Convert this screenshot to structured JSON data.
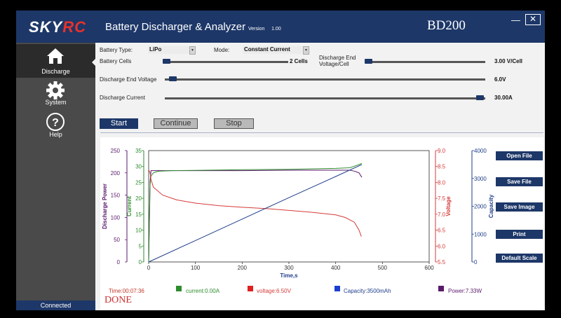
{
  "header": {
    "logo_sky": "SKY",
    "logo_rc": "RC",
    "title": "Battery Discharger & Analyzer",
    "version_label": "Version",
    "version_number": "1.00",
    "model": "BD200",
    "close_glyph": "✕",
    "minimize_glyph": "—"
  },
  "sidebar": {
    "items": [
      {
        "label": "Discharge",
        "icon": "home-icon"
      },
      {
        "label": "System",
        "icon": "gear-icon"
      },
      {
        "label": "Help",
        "icon": "help-icon"
      }
    ],
    "status": "Connected"
  },
  "settings": {
    "battery_type_label": "Battery Type:",
    "battery_type_value": "LiPo",
    "mode_label": "Mode:",
    "mode_value": "Constant Current",
    "battery_cells_label": "Battery Cells",
    "battery_cells_value": "2 Cells",
    "discharge_end_cell_label_1": "Discharge End",
    "discharge_end_cell_label_2": "Voltage/Cell",
    "discharge_end_cell_value": "3.00 V/Cell",
    "discharge_end_voltage_label": "Discharge End Voltage",
    "discharge_end_voltage_value": "6.0V",
    "discharge_current_label": "Discharge Current",
    "discharge_current_value": "30.00A"
  },
  "controls": {
    "start": "Start",
    "continue": "Continue",
    "stop": "Stop"
  },
  "side_buttons": {
    "open_file": "Open File",
    "save_file": "Save File",
    "save_image": "Save Image",
    "print": "Print",
    "default_scale": "Default Scale"
  },
  "legend": {
    "time": "Time:00:07:36",
    "current": "current:0.00A",
    "voltage": "voltage:6.50V",
    "capacity": "Capacity:3500mAh",
    "power": "Power:7.33W",
    "done": "DONE"
  },
  "colors": {
    "brand_blue": "#1d3768",
    "brand_red": "#e8322b",
    "power": "#5a1a6a",
    "current": "#2e8b2e",
    "voltage": "#d63a3a",
    "capacity": "#1f3d8a"
  },
  "chart_data": {
    "type": "line",
    "xlabel": "Time,s",
    "x_ticks": [
      "0",
      "100",
      "200",
      "300",
      "400",
      "500",
      "600"
    ],
    "xlim": [
      0,
      600
    ],
    "axes": {
      "power": {
        "label": "Discharge Power",
        "ticks": [
          "250",
          "200",
          "150",
          "100",
          "50",
          "0"
        ],
        "range": [
          0,
          250
        ]
      },
      "current": {
        "label": "Current",
        "ticks": [
          "35",
          "30",
          "25",
          "20",
          "15",
          "10",
          "5",
          "0"
        ],
        "range": [
          0,
          35
        ]
      },
      "voltage": {
        "label": "Voltage",
        "ticks": [
          "9.0",
          "8.5",
          "8.0",
          "7.5",
          "7.0",
          "6.5",
          "6.0",
          "5.5"
        ],
        "range": [
          5.5,
          9.0
        ]
      },
      "capacity": {
        "label": "Capacity",
        "ticks": [
          "4000",
          "3000",
          "2000",
          "1000",
          "0"
        ],
        "range": [
          0,
          4000
        ]
      }
    },
    "series": [
      {
        "key": "power",
        "axis": "power",
        "x": [
          0,
          3,
          5,
          20,
          50,
          100,
          200,
          300,
          400,
          430,
          440,
          450,
          456
        ],
        "y": [
          0,
          180,
          205,
          205,
          205,
          205,
          205,
          206,
          206,
          206,
          204,
          200,
          190
        ]
      },
      {
        "key": "current",
        "axis": "current",
        "x": [
          0,
          3,
          5,
          10,
          20,
          50,
          100,
          200,
          300,
          400,
          430,
          450,
          456
        ],
        "y": [
          0,
          24,
          27,
          28,
          28.5,
          28.7,
          28.8,
          29,
          29.1,
          29.4,
          29.6,
          30.6,
          31
        ]
      },
      {
        "key": "voltage",
        "axis": "voltage",
        "x": [
          0,
          3,
          5,
          10,
          30,
          60,
          100,
          150,
          200,
          250,
          300,
          350,
          400,
          420,
          440,
          450,
          455
        ],
        "y": [
          8.4,
          8.3,
          8.1,
          7.85,
          7.6,
          7.45,
          7.35,
          7.27,
          7.22,
          7.18,
          7.12,
          7.06,
          6.98,
          6.9,
          6.75,
          6.5,
          6.3
        ]
      },
      {
        "key": "capacity",
        "axis": "capacity",
        "x": [
          0,
          100,
          200,
          300,
          400,
          456
        ],
        "y": [
          0,
          770,
          1540,
          2310,
          3070,
          3500
        ]
      }
    ]
  }
}
